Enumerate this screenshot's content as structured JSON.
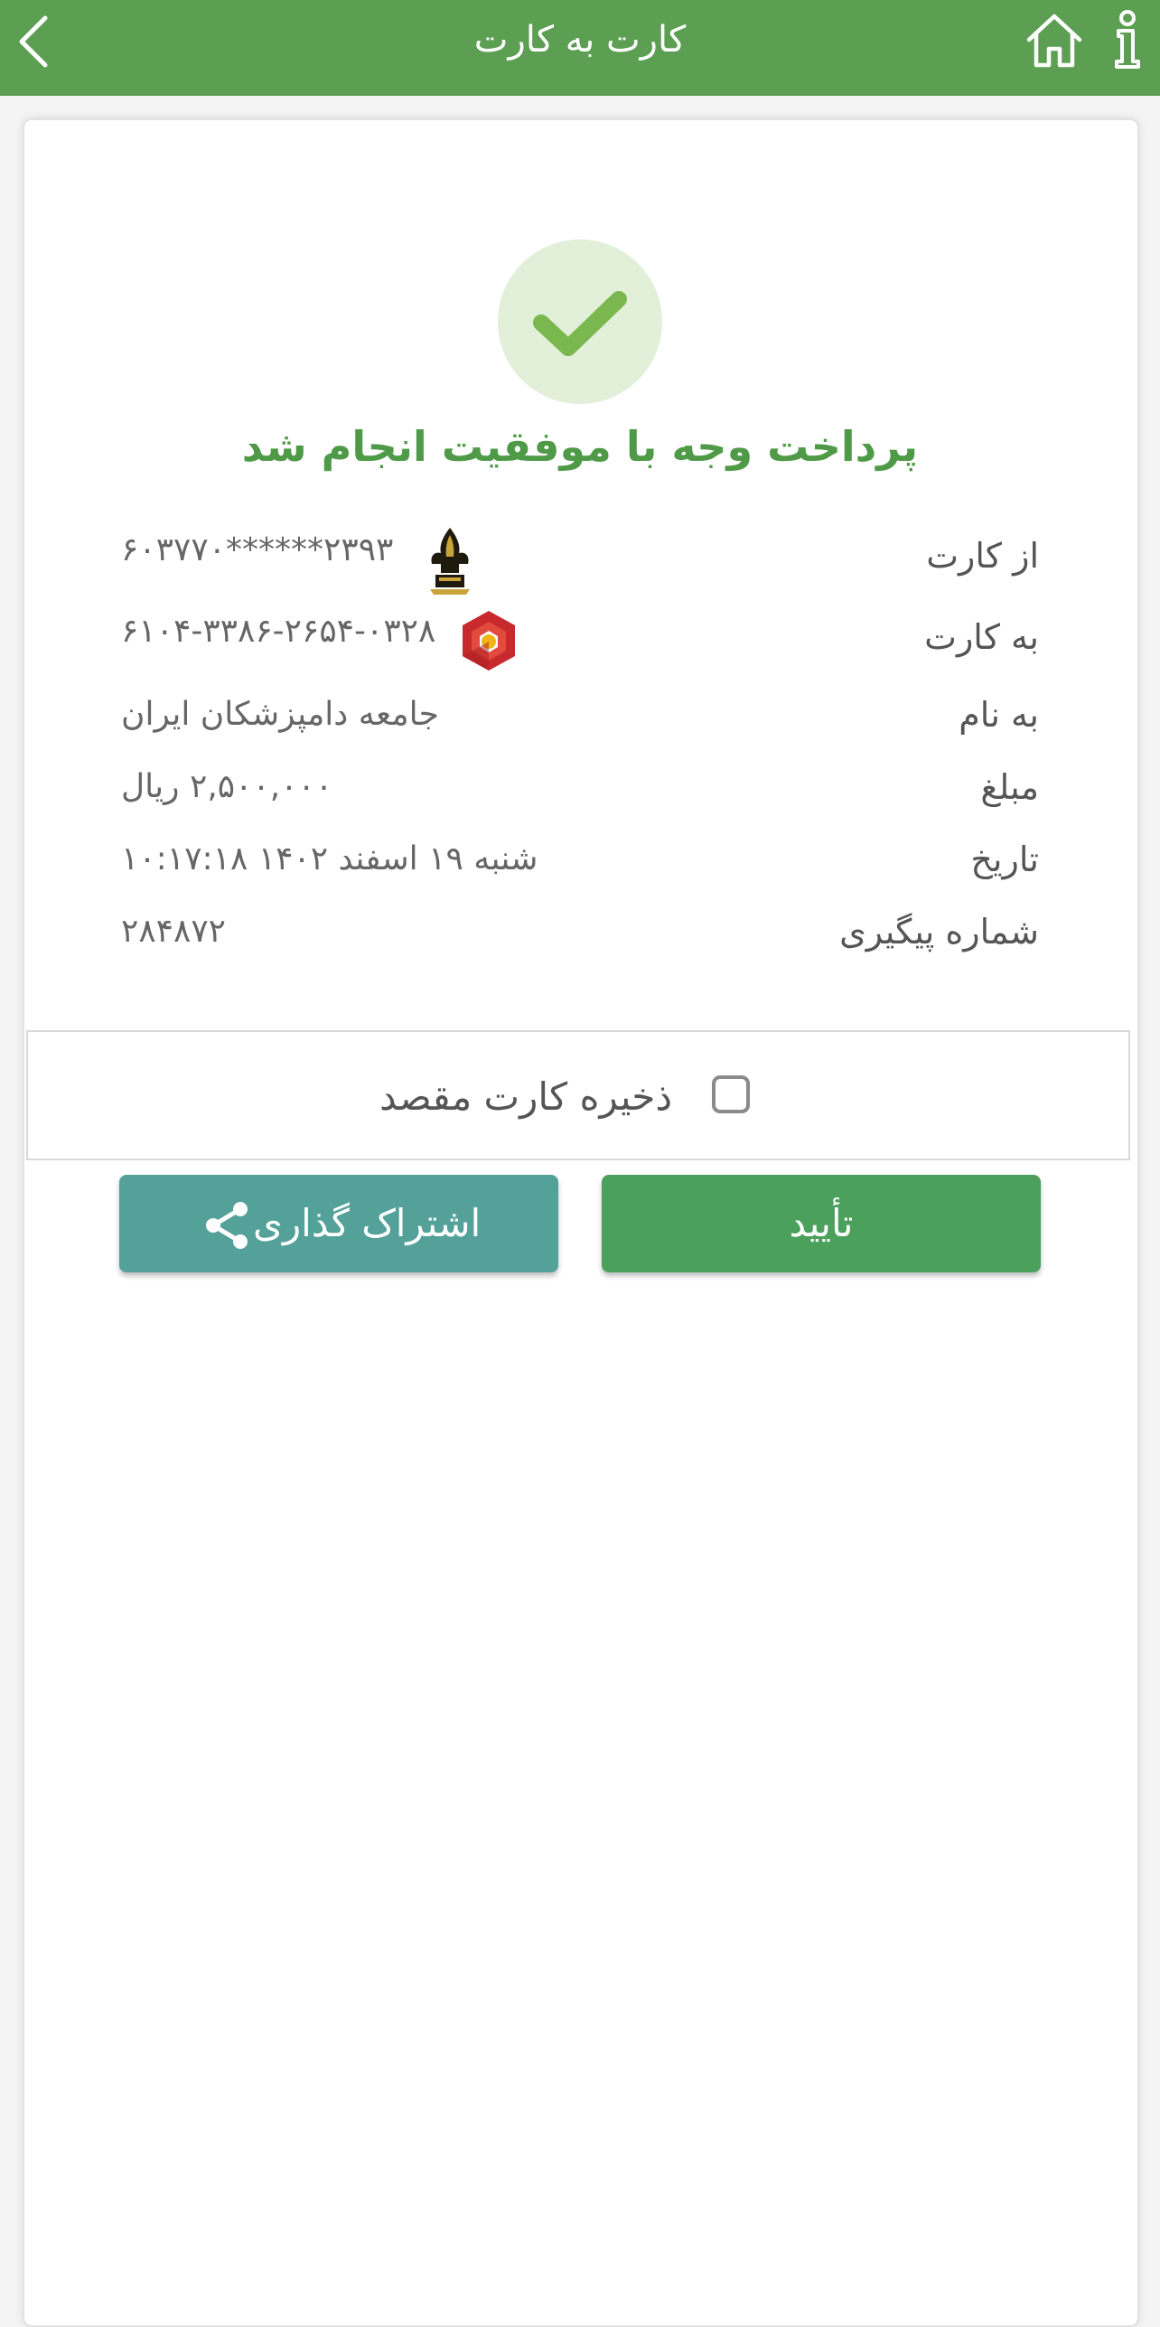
{
  "header": {
    "title": "کارت به کارت"
  },
  "status": {
    "message": "پرداخت وجه با موفقیت انجام شد"
  },
  "details": {
    "from_card": {
      "label": "از کارت",
      "value": "۶۰۳۷۷۰******۲۳۹۳",
      "bank_icon": "bank-keshavarzi-logo"
    },
    "to_card": {
      "label": "به کارت",
      "value": "۶۱۰۴-۳۳۸۶-۲۶۵۴-۰۳۲۸",
      "bank_icon": "bank-mellat-logo"
    },
    "name": {
      "label": "به نام",
      "value": "جامعه دامپزشکان ایران"
    },
    "amount": {
      "label": "مبلغ",
      "value": "۲,۵۰۰,۰۰۰ ریال"
    },
    "date": {
      "label": "تاریخ",
      "value": "شنبه ۱۹ اسفند ۱۴۰۲ ۱۰:۱۷:۱۸"
    },
    "tracking": {
      "label": "شماره پیگیری",
      "value": "۲۸۴۸۷۲"
    }
  },
  "save_card": {
    "label": "ذخیره کارت مقصد",
    "checked": false
  },
  "buttons": {
    "confirm_label": "تأیید",
    "share_label": "اشتراک گذاری"
  },
  "colors": {
    "header": "#5c9f53",
    "success": "#4e9a47",
    "confirm": "#4ba05c",
    "share": "#54a19a"
  },
  "icons": {
    "back": "chevron-left-icon",
    "home": "home-icon",
    "info": "info-icon",
    "success": "checkmark-icon",
    "share": "share-icon"
  }
}
